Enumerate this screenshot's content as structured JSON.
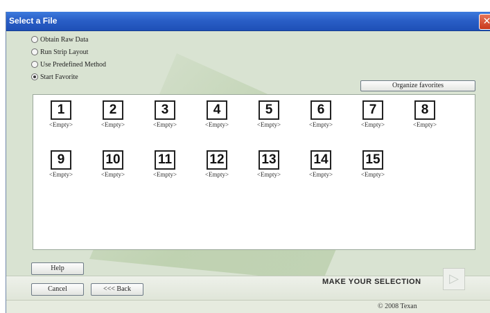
{
  "window": {
    "title": "Select a File",
    "close_glyph": "✕"
  },
  "options": [
    {
      "label": "Obtain Raw Data",
      "checked": false
    },
    {
      "label": "Run Strip Layout",
      "checked": false
    },
    {
      "label": "Use Predefined Method",
      "checked": false
    },
    {
      "label": "Start Favorite",
      "checked": true
    }
  ],
  "organize_button": "Organize favorites",
  "favorites": [
    {
      "num": "1",
      "label": "<Empty>"
    },
    {
      "num": "2",
      "label": "<Empty>"
    },
    {
      "num": "3",
      "label": "<Empty>"
    },
    {
      "num": "4",
      "label": "<Empty>"
    },
    {
      "num": "5",
      "label": "<Empty>"
    },
    {
      "num": "6",
      "label": "<Empty>"
    },
    {
      "num": "7",
      "label": "<Empty>"
    },
    {
      "num": "8",
      "label": "<Empty>"
    },
    {
      "num": "9",
      "label": "<Empty>"
    },
    {
      "num": "10",
      "label": "<Empty>"
    },
    {
      "num": "11",
      "label": "<Empty>"
    },
    {
      "num": "12",
      "label": "<Empty>"
    },
    {
      "num": "13",
      "label": "<Empty>"
    },
    {
      "num": "14",
      "label": "<Empty>"
    },
    {
      "num": "15",
      "label": "<Empty>"
    }
  ],
  "buttons": {
    "help": "Help",
    "cancel": "Cancel",
    "back": "<<< Back",
    "next_glyph": "▷"
  },
  "prompt": "MAKE YOUR SELECTION",
  "copyright": "© 2008 Texan"
}
